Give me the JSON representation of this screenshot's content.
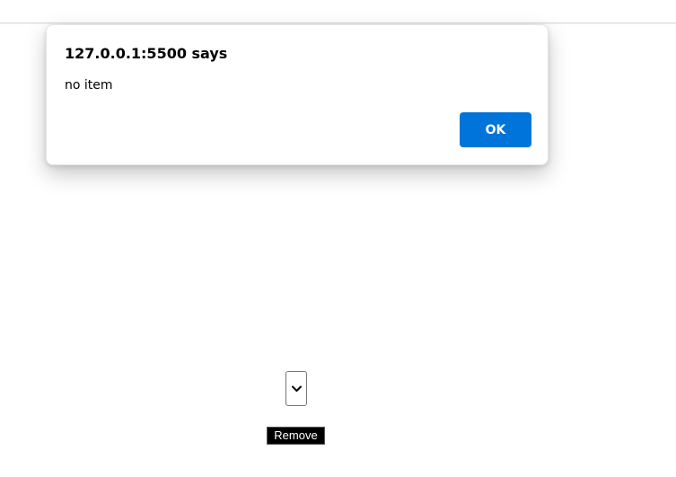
{
  "alert": {
    "title": "127.0.0.1:5500 says",
    "message": "no item",
    "ok_label": "OK"
  },
  "page": {
    "remove_label": "Remove"
  },
  "icons": {
    "dropdown": "chevron-down-icon"
  },
  "colors": {
    "ok_button": "#0074d9",
    "remove_button": "#000000"
  }
}
